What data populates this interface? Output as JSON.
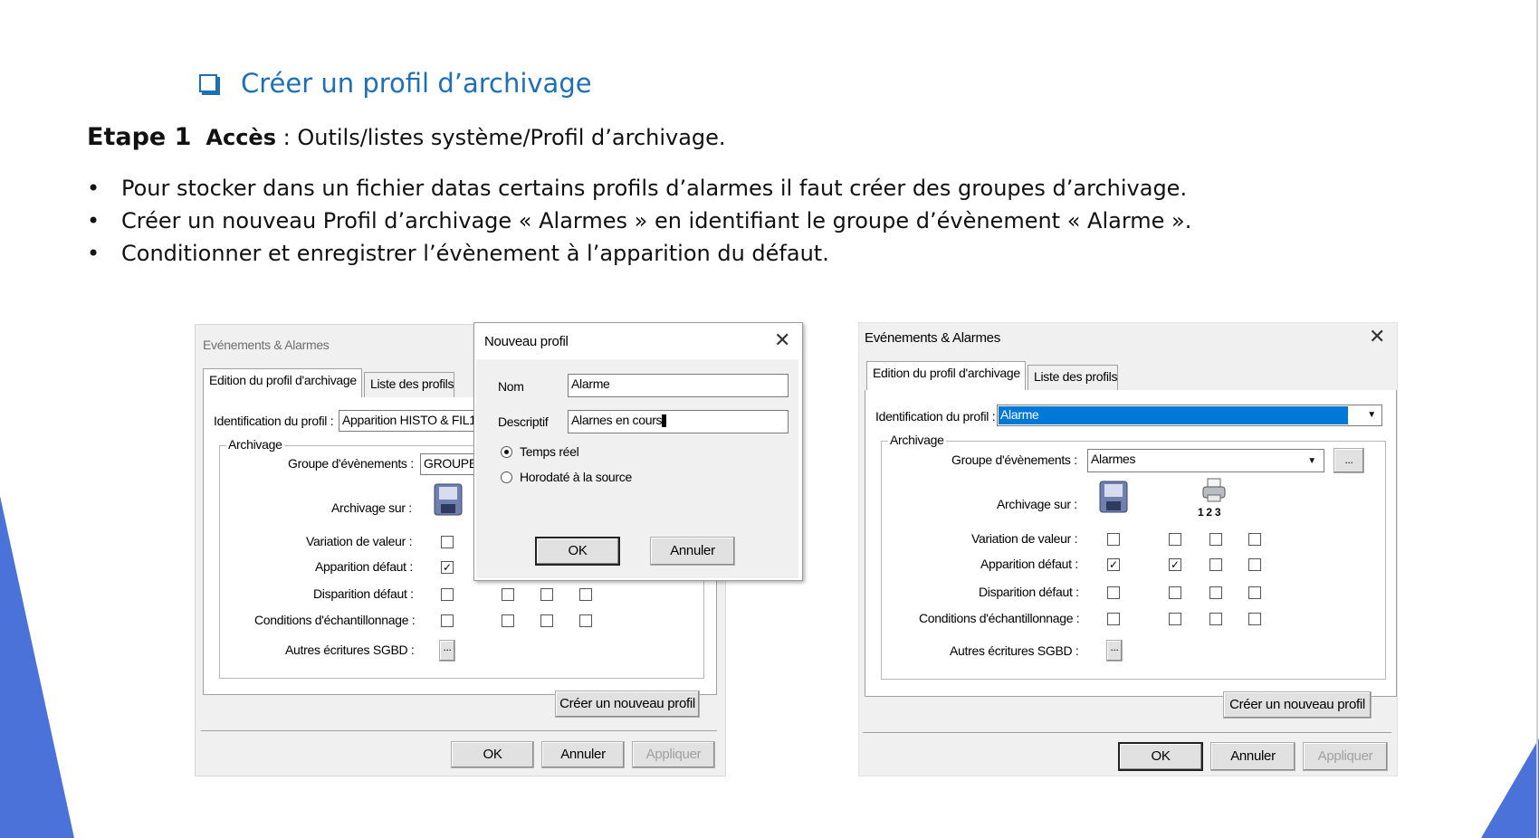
{
  "slide": {
    "title": "Créer un profil d’archivage",
    "step": {
      "label": "Etape 1",
      "acces_label": "Accès",
      "acces_text": " : Outils/listes système/Profil d’archivage."
    },
    "bullets": [
      "Pour stocker dans un fichier datas certains profils d’alarmes il faut créer des groupes d’archivage.",
      "Créer un nouveau Profil d’archivage « Alarmes » en identifiant le groupe d’évènement « Alarme ».",
      "Conditionner et enregistrer l’évènement à l’apparition du défaut."
    ],
    "bullet_glyph": "•",
    "accent_color": "#4a72d8",
    "title_color": "#1f6fb5"
  },
  "left_dialog": {
    "title": "Evénements & Alarmes",
    "tabs": [
      "Edition du profil d'archivage",
      "Liste des profils"
    ],
    "id_label": "Identification du profil :",
    "id_value": "Apparition HISTO & FIL1",
    "group_legend": "Archivage",
    "groupe_label": "Groupe d'évènements :",
    "groupe_value": "GROUPE",
    "archivage_label": "Archivage sur :",
    "rows": [
      {
        "label": "Variation de valeur :",
        "checks": [
          false
        ]
      },
      {
        "label": "Apparition défaut :",
        "checks": [
          true
        ]
      },
      {
        "label": "Disparition défaut :",
        "checks": [
          false,
          false,
          false,
          false
        ]
      },
      {
        "label": "Conditions d'échantillonnage :",
        "checks": [
          false,
          false,
          false,
          false
        ]
      }
    ],
    "autres_label": "Autres écritures SGBD :",
    "ellipsis": "...",
    "create_button": "Créer un nouveau profil",
    "ok": "OK",
    "cancel": "Annuler",
    "apply": "Appliquer"
  },
  "new_profile_dialog": {
    "title": "Nouveau profil",
    "close": "✕",
    "nom_label": "Nom",
    "nom_value": "Alarme",
    "desc_label": "Descriptif",
    "desc_value": "Alarnes en cours",
    "radio_realtime": "Temps réel",
    "radio_source": "Horodaté à la source",
    "ok": "OK",
    "cancel": "Annuler"
  },
  "right_dialog": {
    "title": "Evénements & Alarmes",
    "close": "✕",
    "tabs": [
      "Edition du profil d'archivage",
      "Liste des profils"
    ],
    "id_label": "Identification du profil :",
    "id_value": "Alarme",
    "group_legend": "Archivage",
    "groupe_label": "Groupe d'évènements :",
    "groupe_value": "Alarmes",
    "archivage_label": "Archivage sur :",
    "printer_numbers": "1  2  3",
    "rows": [
      {
        "label": "Variation de valeur :",
        "checks": [
          false,
          false,
          false,
          false
        ]
      },
      {
        "label": "Apparition défaut :",
        "checks": [
          true,
          true,
          false,
          false
        ]
      },
      {
        "label": "Disparition défaut :",
        "checks": [
          false,
          false,
          false,
          false
        ]
      },
      {
        "label": "Conditions d'échantillonnage :",
        "checks": [
          false,
          false,
          false,
          false
        ]
      }
    ],
    "autres_label": "Autres écritures SGBD :",
    "ellipsis": "...",
    "create_button": "Créer un nouveau profil",
    "ok": "OK",
    "cancel": "Annuler",
    "apply": "Appliquer",
    "selection_color": "#0078d7"
  }
}
